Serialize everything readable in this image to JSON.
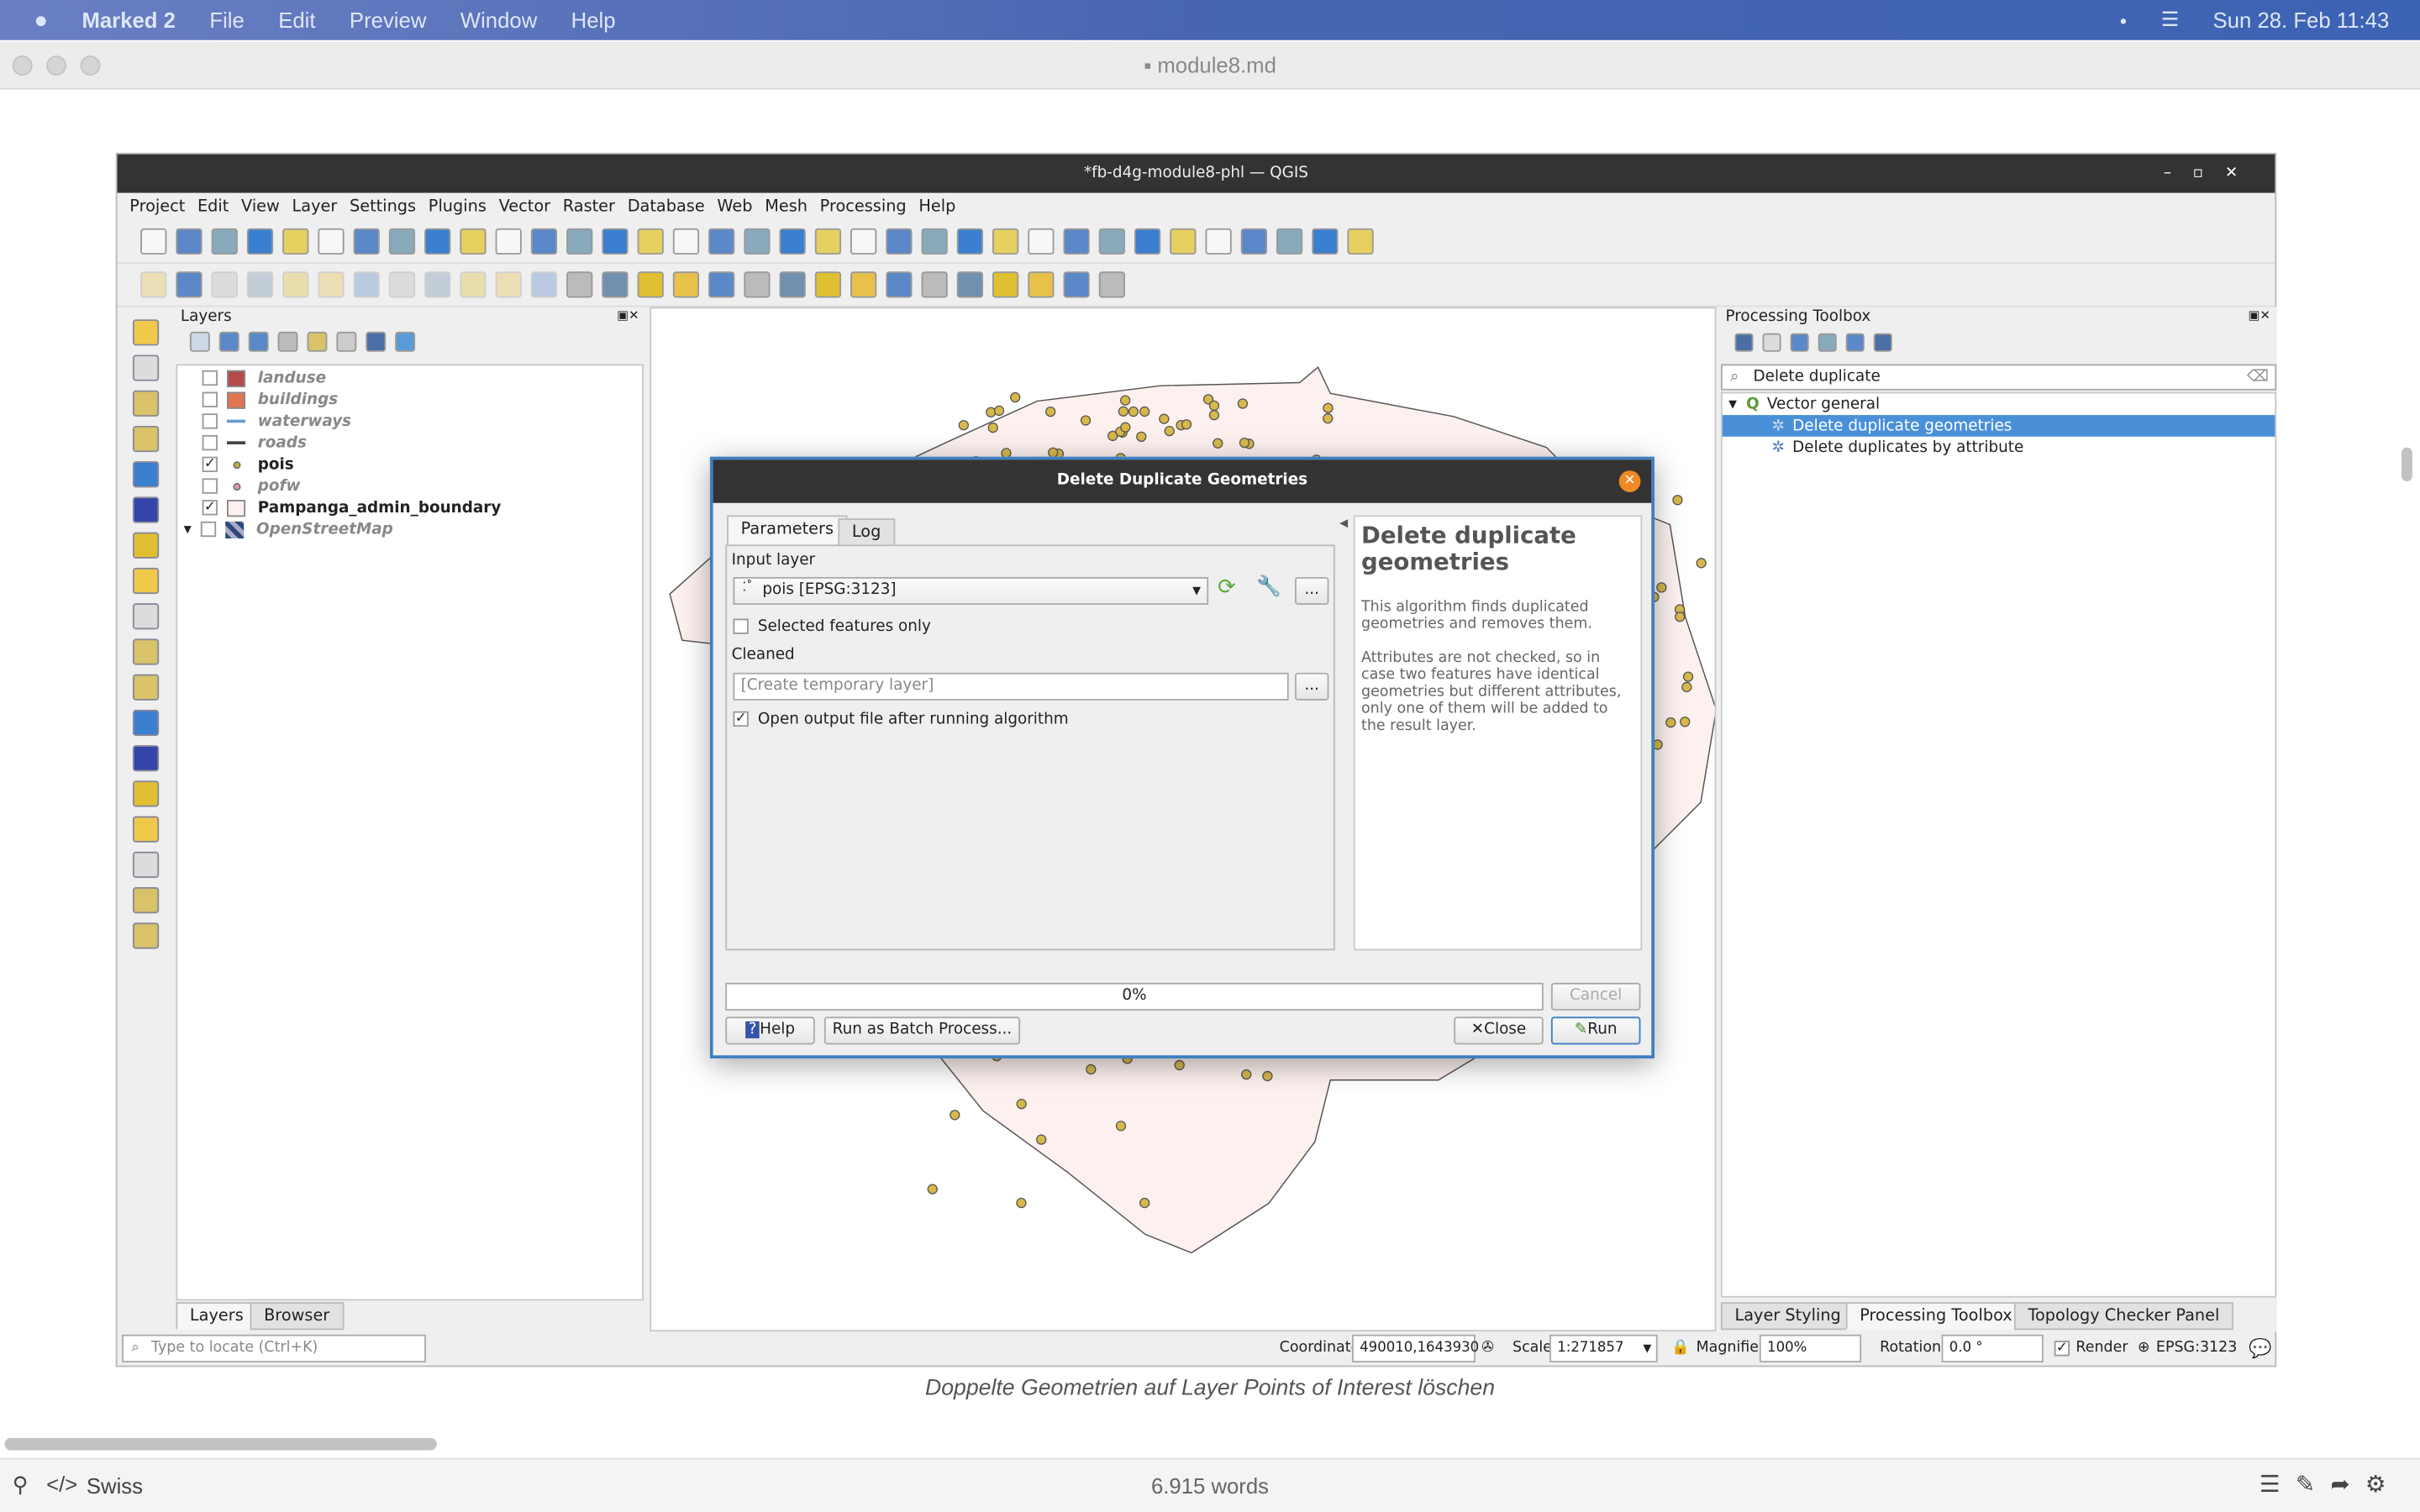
{
  "mac_menubar": {
    "app": "Marked 2",
    "items": [
      "File",
      "Edit",
      "Preview",
      "Window",
      "Help"
    ],
    "clock": "Sun 28. Feb  11:43"
  },
  "window": {
    "title": "module8.md"
  },
  "qgis": {
    "title": "*fb-d4g-module8-phl — QGIS",
    "menu": [
      "Project",
      "Edit",
      "View",
      "Layer",
      "Settings",
      "Plugins",
      "Vector",
      "Raster",
      "Database",
      "Web",
      "Mesh",
      "Processing",
      "Help"
    ],
    "toolbar1_icons": [
      "new-project",
      "open-project",
      "save-project",
      "new-print-layout",
      "layout-manager",
      "style-manager",
      "pan",
      "pan-to-selection",
      "zoom-in",
      "zoom-out",
      "zoom-full",
      "zoom-to-selection",
      "zoom-to-layer",
      "zoom-native",
      "zoom-last",
      "zoom-next",
      "new-bookmark",
      "show-bookmarks",
      "new-spatial-bookmark",
      "show-spatial-bookmarks",
      "temporal-controller",
      "refresh",
      "identify",
      "attribute-table",
      "field-calculator",
      "processing-toolbox",
      "statistics",
      "measure",
      "map-tips",
      "actions",
      "text-annotation",
      "select-features",
      "select-by-value",
      "deselect",
      "select-location"
    ],
    "toolbar2_icons": [
      "current-edits",
      "toggle-editing",
      "save-edits",
      "add-point",
      "vertex-tool",
      "modify-attributes",
      "delete-selected",
      "cut",
      "copy",
      "paste",
      "undo",
      "redo",
      "label-tool",
      "diagram",
      "pin-labels",
      "show-hide-labels",
      "move-label",
      "rotate-label",
      "change-label",
      "label-properties",
      "highlight-labels",
      "osm-place-search",
      "python-console",
      "globe",
      "help",
      "georeferencer",
      "quickosm",
      "plugin-tool"
    ],
    "layers_panel": {
      "title": "Layers",
      "layers": [
        {
          "name": "landuse",
          "checked": false,
          "style": "fill",
          "color": "#b54a4a",
          "italic": true
        },
        {
          "name": "buildings",
          "checked": false,
          "style": "fill",
          "color": "#e07650",
          "italic": true
        },
        {
          "name": "waterways",
          "checked": false,
          "style": "line",
          "color": "#6a9bd6",
          "italic": true
        },
        {
          "name": "roads",
          "checked": false,
          "style": "line",
          "color": "#444444",
          "italic": true
        },
        {
          "name": "pois",
          "checked": true,
          "style": "point",
          "color": "#c9a83a",
          "italic": false
        },
        {
          "name": "pofw",
          "checked": false,
          "style": "point",
          "color": "#e59aa7",
          "italic": true
        },
        {
          "name": "Pampanga_admin_boundary",
          "checked": true,
          "style": "fill",
          "color": "#fdf1ef",
          "italic": false
        },
        {
          "name": "OpenStreetMap",
          "checked": false,
          "style": "raster",
          "color": "#2b4a7a",
          "italic": true
        }
      ],
      "tabs": [
        "Layers",
        "Browser"
      ]
    },
    "processing_toolbox": {
      "title": "Processing Toolbox",
      "search_value": "Delete duplicate",
      "group": "Vector general",
      "items": [
        "Delete duplicate geometries",
        "Delete duplicates by attribute"
      ],
      "selected": "Delete duplicate geometries",
      "tabs": [
        "Layer Styling",
        "Processing Toolbox",
        "Topology Checker Panel"
      ]
    },
    "statusbar": {
      "locate_placeholder": "Type to locate (Ctrl+K)",
      "coordinate_label": "Coordinate",
      "coordinate": "490010,1643930",
      "scale_label": "Scale",
      "scale": "1:271857",
      "magnifier_label": "Magnifier",
      "magnifier": "100%",
      "rotation_label": "Rotation",
      "rotation": "0.0 °",
      "render_label": "Render",
      "render_checked": true,
      "crs": "EPSG:3123"
    }
  },
  "dialog": {
    "title": "Delete Duplicate Geometries",
    "tabs": [
      "Parameters",
      "Log"
    ],
    "input_layer_label": "Input layer",
    "input_layer_value": "pois [EPSG:3123]",
    "selected_only_label": "Selected features only",
    "selected_only": false,
    "cleaned_label": "Cleaned",
    "cleaned_placeholder": "[Create temporary layer]",
    "open_output_label": "Open output file after running algorithm",
    "open_output": true,
    "help_title": "Delete duplicate geometries",
    "help_p1": "This algorithm finds duplicated geometries and removes them.",
    "help_p2": "Attributes are not checked, so in case two features have identical geometries but different attributes, only one of them will be added to the result layer.",
    "progress": "0%",
    "cancel": "Cancel",
    "help": "Help",
    "batch": "Run as Batch Process...",
    "close": "Close",
    "run": "Run",
    "more": "..."
  },
  "caption": "Doppelte Geometrien auf Layer Points of Interest löschen",
  "bottombar": {
    "style": "Swiss",
    "words": "6.915 words"
  },
  "colors": {
    "accent": "#3d7fc1",
    "selection": "#4a90d9",
    "poi": "#d8b84a",
    "boundary_fill": "#fdf1ef",
    "dialog_close": "#f08a24"
  }
}
